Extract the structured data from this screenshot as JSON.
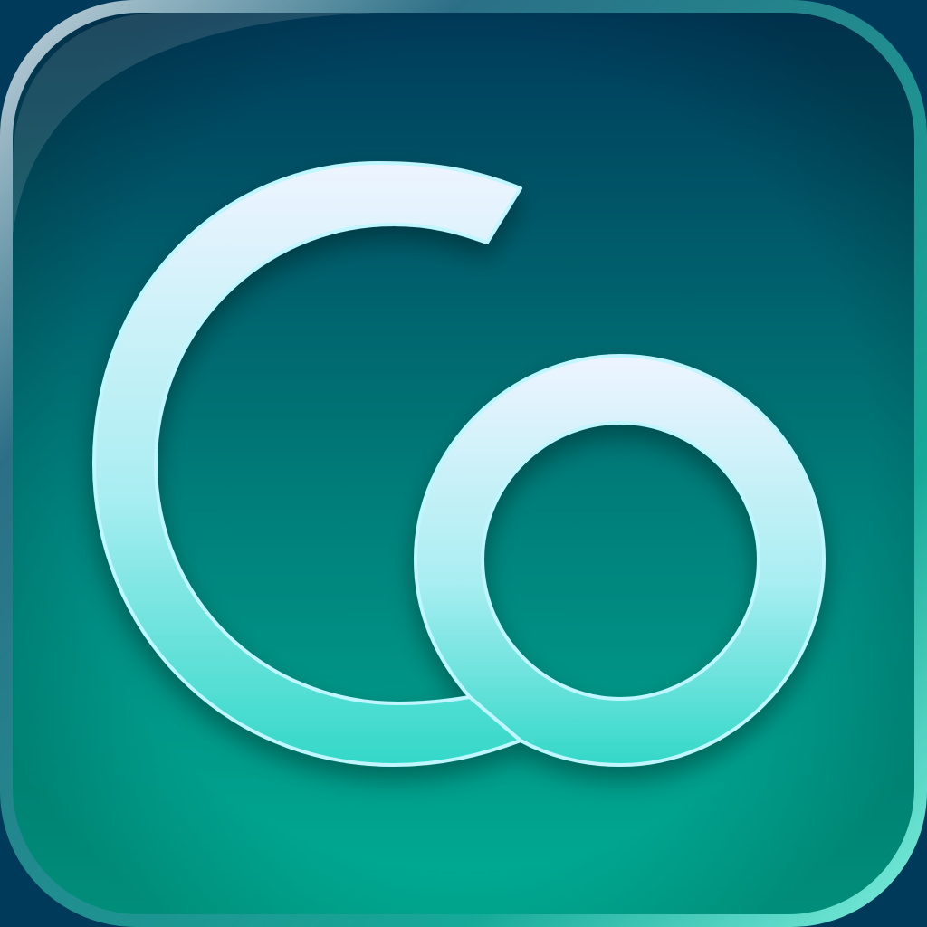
{
  "icon": {
    "name": "app-icon",
    "glyph": "Co",
    "colors": {
      "background_top": "#003b5b",
      "background_mid": "#007f7a",
      "background_bottom": "#00ad94",
      "rim_top_left": "#c7d6df",
      "rim_bottom_right": "#7ff0df",
      "letter_top": "#eef4ff",
      "letter_mid": "#a9eef2",
      "letter_bottom": "#33d8c8",
      "letter_edge": "#bff6ff"
    }
  }
}
